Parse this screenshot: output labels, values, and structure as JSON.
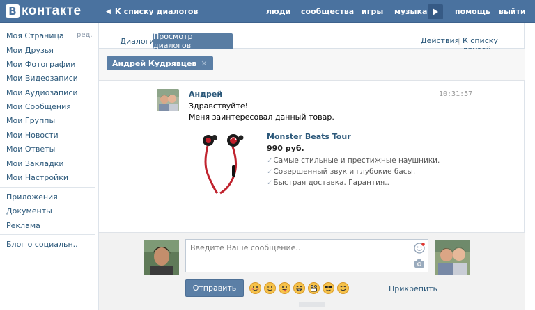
{
  "header": {
    "logo_letter": "В",
    "logo_text": "контакте",
    "back_link": "К списку диалогов",
    "nav": [
      "люди",
      "сообщества",
      "игры",
      "музыка",
      "помощь",
      "выйти"
    ]
  },
  "sidebar": {
    "edit_label": "ред.",
    "items": [
      "Моя Страница",
      "Мои Друзья",
      "Мои Фотографии",
      "Мои Видеозаписи",
      "Мои Аудиозаписи",
      "Мои Сообщения",
      "Мои Группы",
      "Мои Новости",
      "Мои Ответы",
      "Мои Закладки",
      "Мои Настройки"
    ],
    "items2": [
      "Приложения",
      "Документы",
      "Реклама"
    ],
    "items3": [
      "Блог о социальн.."
    ]
  },
  "tabs": {
    "dialogs": "Диалоги",
    "view": "Просмотр диалогов",
    "actions": "Действия",
    "friends": "К списку друзей"
  },
  "filter": {
    "chip_label": "Андрей Кудрявцев"
  },
  "message": {
    "author": "Андрей",
    "time": "10:31:57",
    "lines": [
      "Здравствуйте!",
      "Меня заинтересовал данный товар."
    ],
    "product": {
      "name": "Monster Beats Tour",
      "price": "990 руб.",
      "features": [
        "Самые стильные и престижные наушники.",
        "Совершенный звук и глубокие басы.",
        "Быстрая доставка. Гарантия.."
      ]
    }
  },
  "composer": {
    "placeholder": "Введите Ваше сообщение..",
    "send_label": "Отправить",
    "attach_label": "Прикрепить"
  },
  "colors": {
    "header_bg": "#4a729f",
    "link": "#2b587a",
    "accent": "#5b7fa6"
  }
}
